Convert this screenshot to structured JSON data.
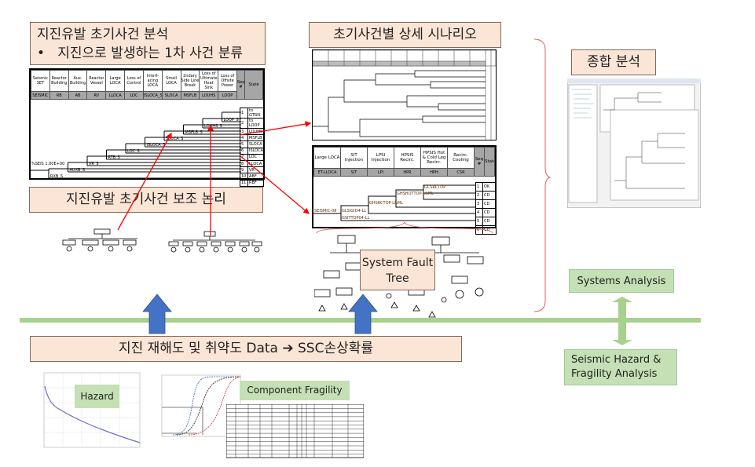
{
  "titles": {
    "initiating": "지진유발 초기사건 분석",
    "initiating_bullet": "지진으로 발생하는 1차 사건 분류",
    "support_logic": "지진유발 초기사건 보조 논리",
    "scenario": "초기사건별 상세 시나리오",
    "integrated": "종합 분석",
    "system_ft": "System Fault Tree",
    "data": "지진 재해도 및 취약도 Data ➔ SSC손상확률",
    "systems_analysis": "Systems Analysis",
    "hazard_fragility": "Seismic Hazard & Fragility Analysis",
    "hazard": "Hazard",
    "component_fragility": "Component Fragility"
  },
  "seismic_et": {
    "headers": [
      "Seismic SET",
      "Reactor Building",
      "Aux. Building",
      "Reactor Vessel",
      "Large LOCA",
      "Loss of Control",
      "Interf-acing LOCA",
      "Small LOCA",
      "2ndary Side Line Break",
      "Loss of Ultimate Heat Sink",
      "Loss of Offsite Power",
      "Seq #",
      "State"
    ],
    "codes": [
      "SEISMIC",
      "RB",
      "AB",
      "RV",
      "LLOCA",
      "LOC",
      "ISLOCA_S",
      "SLOCA",
      "MSFLB",
      "LOUHS",
      "LOOP"
    ],
    "branches": [
      "LOOP_S",
      "LOUHS_S",
      "MSFLB_S",
      "SLOCA_S",
      "ISLOCA_S",
      "LOC_S",
      "RTB_S",
      "VR_S",
      "AUXB_S",
      "RXB_S"
    ],
    "init": "%SEIS 1.00E+00",
    "seq": [
      "1",
      "2",
      "3",
      "4",
      "5",
      "6",
      "7",
      "8",
      "9",
      "10",
      "11"
    ],
    "state": [
      "to GTRN",
      "to LOOP",
      "LOUHS",
      "MSFLB",
      "SLOCA",
      "ISLOCA",
      "LOC",
      "LLOCA",
      "VR",
      "ABF",
      "RBF"
    ]
  },
  "llocа_et": {
    "headers": [
      "Large LOCA",
      "SIT Injection",
      "LPSI Injection",
      "HPSIS Recirc.",
      "HPSIS Hot & Cold Leg Recirc.",
      "Recirc. Cooling",
      "Seq #",
      "State"
    ],
    "codes": [
      "ET-LLOCA",
      "SIT",
      "LPI",
      "HPR",
      "HPH",
      "CSR"
    ],
    "init": "SEISMIC-08",
    "branches": [
      "GCSRCTOP",
      "GHSHOTTOP-L&ML",
      "GHSRCTOP-L&ML",
      "GLSIGIO4-LL",
      "GSITTOP04-LL"
    ],
    "seq": [
      "1",
      "2",
      "3",
      "4",
      "5",
      "6"
    ],
    "state": [
      "OK",
      "CD",
      "CD",
      "CD",
      "CD",
      "CD"
    ]
  },
  "colors": {
    "peach": "#fbe5d6",
    "green": "#c5e0b4",
    "ground_line": "#a9d18e",
    "arrow_blue": "#4472c4",
    "arrow_red": "#ff0000"
  }
}
